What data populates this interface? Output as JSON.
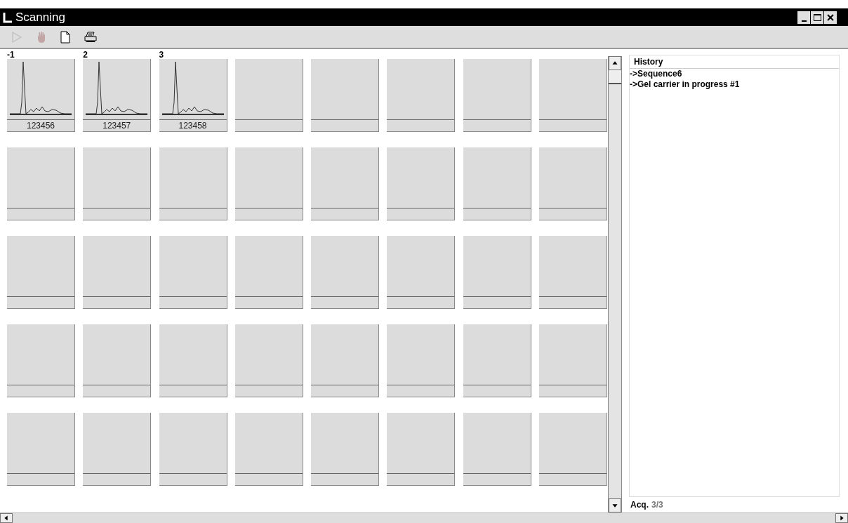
{
  "window": {
    "title": "Scanning"
  },
  "toolbar": [
    {
      "kind": "play",
      "disabled": true
    },
    {
      "kind": "hand",
      "disabled": true
    },
    {
      "kind": "new",
      "disabled": false
    },
    {
      "kind": "print",
      "disabled": false
    }
  ],
  "wells": [
    {
      "number": "-1",
      "id": "123456",
      "trace": true
    },
    {
      "number": "2",
      "id": "123457",
      "trace": true
    },
    {
      "number": "3",
      "id": "123458",
      "trace": true
    },
    {
      "trace": false
    },
    {
      "trace": false
    },
    {
      "trace": false
    },
    {
      "trace": false
    },
    {
      "trace": false
    },
    {
      "trace": false
    },
    {
      "trace": false
    },
    {
      "trace": false
    },
    {
      "trace": false
    },
    {
      "trace": false
    },
    {
      "trace": false
    },
    {
      "trace": false
    },
    {
      "trace": false
    },
    {
      "trace": false
    },
    {
      "trace": false
    },
    {
      "trace": false
    },
    {
      "trace": false
    },
    {
      "trace": false
    },
    {
      "trace": false
    },
    {
      "trace": false
    },
    {
      "trace": false
    },
    {
      "trace": false
    },
    {
      "trace": false
    },
    {
      "trace": false
    },
    {
      "trace": false
    },
    {
      "trace": false
    },
    {
      "trace": false
    },
    {
      "trace": false
    },
    {
      "trace": false
    },
    {
      "trace": false
    },
    {
      "trace": false
    },
    {
      "trace": false
    },
    {
      "trace": false
    },
    {
      "trace": false
    },
    {
      "trace": false
    },
    {
      "trace": false
    },
    {
      "trace": false
    }
  ],
  "history": {
    "title": "History",
    "entries": [
      "->Sequence6",
      "->Gel carrier in progress #1"
    ]
  },
  "status": {
    "label": "Acq.",
    "value": "3/3"
  }
}
